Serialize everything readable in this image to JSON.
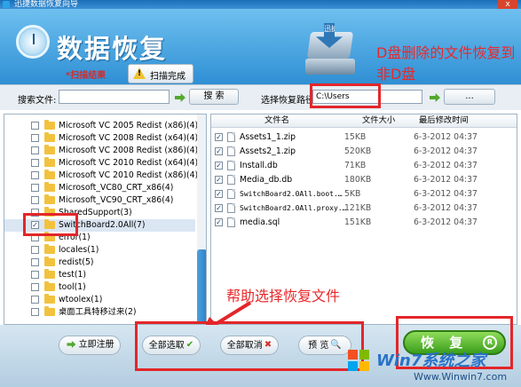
{
  "window": {
    "title": "迅捷数据恢复向导",
    "close_label": "x"
  },
  "header": {
    "app_title": "数据恢复",
    "scan_result_label": "*扫描结果",
    "scan_done_label": "扫描完成",
    "drive_label": "迅捷"
  },
  "annotations": {
    "top_right": "D盘删除的文件恢复到非D盘",
    "bottom": "帮助选择恢复文件"
  },
  "search": {
    "label": "搜索文件:",
    "value": "",
    "button": "搜  索",
    "save_path_label": "选择恢复路径",
    "save_path_value": "C:\\Users",
    "browse_button": "..."
  },
  "tree": {
    "items": [
      {
        "label": "Microsoft VC 2005 Redist (x86)(4)",
        "checked": false
      },
      {
        "label": "Microsoft VC 2008 Redist (x64)(4)",
        "checked": false
      },
      {
        "label": "Microsoft VC 2008 Redist (x86)(4)",
        "checked": false
      },
      {
        "label": "Microsoft VC 2010 Redist (x64)(4)",
        "checked": false
      },
      {
        "label": "Microsoft VC 2010 Redist (x86)(4)",
        "checked": false
      },
      {
        "label": "Microsoft_VC80_CRT_x86(4)",
        "checked": false
      },
      {
        "label": "Microsoft_VC90_CRT_x86(4)",
        "checked": false
      },
      {
        "label": "SharedSupport(3)",
        "checked": false
      },
      {
        "label": "SwitchBoard2.0All(7)",
        "checked": true
      },
      {
        "label": "error(1)",
        "checked": false
      },
      {
        "label": "locales(1)",
        "checked": false
      },
      {
        "label": "redist(5)",
        "checked": false
      },
      {
        "label": "test(1)",
        "checked": false
      },
      {
        "label": "tool(1)",
        "checked": false
      },
      {
        "label": "wtoolex(1)",
        "checked": false
      },
      {
        "label": "桌面工具特移过来(2)",
        "checked": false
      }
    ]
  },
  "files": {
    "columns": {
      "name": "文件名",
      "size": "文件大小",
      "date": "最后修改时间"
    },
    "rows": [
      {
        "name": "Assets1_1.zip",
        "size": "15KB",
        "date": "6-3-2012 04:37",
        "checked": true
      },
      {
        "name": "Assets2_1.zip",
        "size": "520KB",
        "date": "6-3-2012 04:37",
        "checked": true
      },
      {
        "name": "Install.db",
        "size": "71KB",
        "date": "6-3-2012 04:37",
        "checked": true
      },
      {
        "name": "Media_db.db",
        "size": "180KB",
        "date": "6-3-2012 04:37",
        "checked": true
      },
      {
        "name": "SwitchBoard2.0All.boot.…",
        "size": "5KB",
        "date": "6-3-2012 04:37",
        "checked": true
      },
      {
        "name": "SwitchBoard2.0All.proxy.…",
        "size": "121KB",
        "date": "6-3-2012 04:37",
        "checked": true
      },
      {
        "name": "media.sql",
        "size": "151KB",
        "date": "6-3-2012 04:37",
        "checked": true
      }
    ]
  },
  "footer": {
    "register": "立即注册",
    "select_all": "全部选取",
    "deselect_all": "全部取消",
    "preview": "预  览",
    "recover": "恢 复",
    "recover_badge": "R"
  },
  "watermark": {
    "brand": "Win7系统之家",
    "url": "Www.Winwin7.com"
  },
  "colors": {
    "accent": "#2f8fd4",
    "annotation_red": "#e3262a",
    "recover_green": "#3a9e1b"
  }
}
